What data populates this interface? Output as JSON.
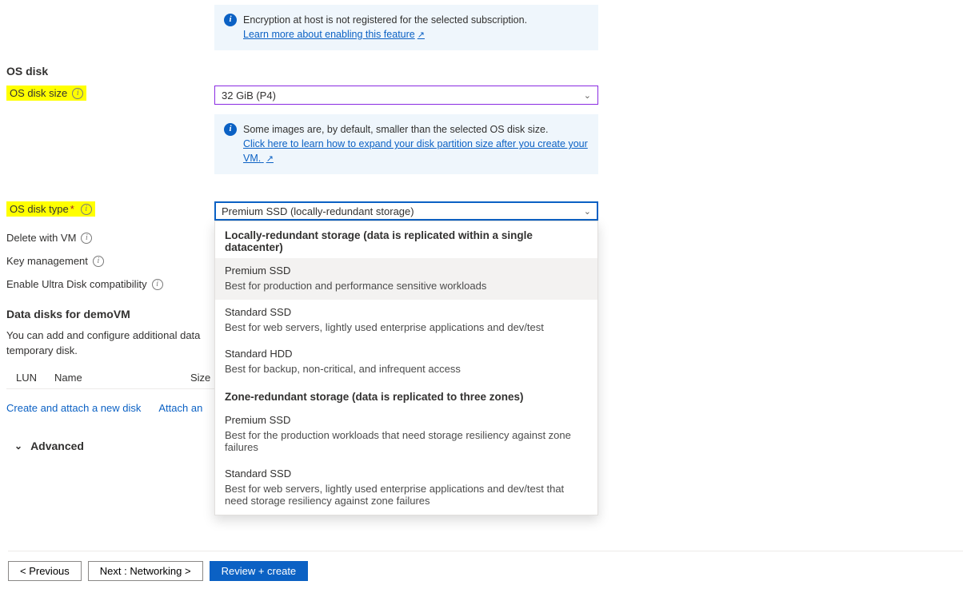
{
  "notices": {
    "encryption": {
      "text": "Encryption at host is not registered for the selected subscription.",
      "link": "Learn more about enabling this feature"
    },
    "image_size": {
      "text": "Some images are, by default, smaller than the selected OS disk size.",
      "link": "Click here to learn how to expand your disk partition size after you create your VM."
    }
  },
  "sections": {
    "os_disk_title": "OS disk",
    "data_disks_title": "Data disks for demoVM",
    "advanced": "Advanced"
  },
  "labels": {
    "os_disk_size": "OS disk size",
    "os_disk_type": "OS disk type",
    "delete_with_vm": "Delete with VM",
    "key_management": "Key management",
    "ultra_disk": "Enable Ultra Disk compatibility"
  },
  "fields": {
    "os_disk_size_value": "32 GiB (P4)",
    "os_disk_type_value": "Premium SSD (locally-redundant storage)"
  },
  "data_disks": {
    "desc": "You can add and configure additional data disks for your virtual machine or attach existing disks. This VM also comes with a temporary disk.",
    "desc_visible": "You can add and configure additional data",
    "desc_visible2": "temporary disk.",
    "columns": {
      "lun": "LUN",
      "name": "Name",
      "size": "Size"
    },
    "links": {
      "create": "Create and attach a new disk",
      "attach": "Attach an"
    }
  },
  "dropdown": {
    "group1": "Locally-redundant storage (data is replicated within a single datacenter)",
    "group2": "Zone-redundant storage (data is replicated to three zones)",
    "opts": [
      {
        "title": "Premium SSD",
        "desc": "Best for production and performance sensitive workloads"
      },
      {
        "title": "Standard SSD",
        "desc": "Best for web servers, lightly used enterprise applications and dev/test"
      },
      {
        "title": "Standard HDD",
        "desc": "Best for backup, non-critical, and infrequent access"
      },
      {
        "title": "Premium SSD",
        "desc": "Best for the production workloads that need storage resiliency against zone failures"
      },
      {
        "title": "Standard SSD",
        "desc": "Best for web servers, lightly used enterprise applications and dev/test that need storage resiliency against zone failures"
      }
    ]
  },
  "footer": {
    "prev": "< Previous",
    "next": "Next : Networking >",
    "review": "Review + create"
  },
  "glyphs": {
    "req": "*",
    "ext": "↗"
  }
}
